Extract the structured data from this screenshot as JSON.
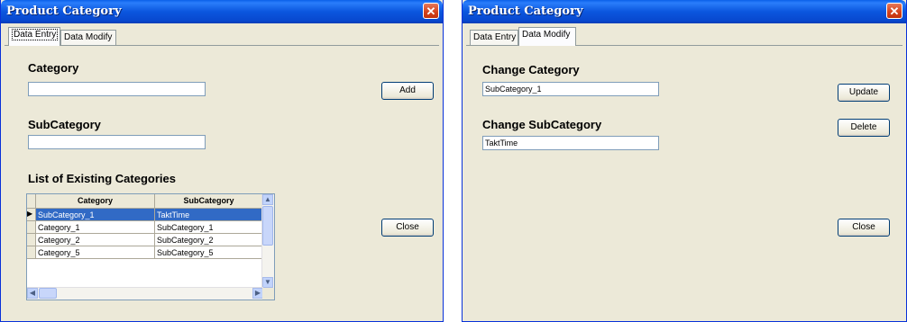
{
  "window1": {
    "title": "Product Category",
    "close_glyph": "✕",
    "tabs": [
      {
        "label": "Data Entry",
        "active": true
      },
      {
        "label": "Data Modify",
        "active": false
      }
    ],
    "category_label": "Category",
    "category_value": "",
    "add_button": "Add",
    "subcategory_label": "SubCategory",
    "subcategory_value": "",
    "list_label": "List of Existing Categories",
    "grid": {
      "columns": [
        "Category",
        "SubCategory"
      ],
      "rows": [
        {
          "category": "SubCategory_1",
          "subcategory": "TaktTime",
          "selected": true,
          "marker": "▶"
        },
        {
          "category": "Category_1",
          "subcategory": "SubCategory_1"
        },
        {
          "category": "Category_2",
          "subcategory": "SubCategory_2"
        },
        {
          "category": "Category_5",
          "subcategory": "SubCategory_5"
        }
      ]
    },
    "close_button": "Close"
  },
  "window2": {
    "title": "Product Category",
    "close_glyph": "✕",
    "tabs": [
      {
        "label": "Data Entry",
        "active": false
      },
      {
        "label": "Data Modify",
        "active": true
      }
    ],
    "change_category_label": "Change Category",
    "change_category_value": "SubCategory_1",
    "update_button": "Update",
    "change_subcategory_label": "Change SubCategory",
    "change_subcategory_value": "TaktTime",
    "delete_button": "Delete",
    "close_button": "Close"
  },
  "icons": {
    "scroll_up": "▲",
    "scroll_down": "▼",
    "scroll_left": "◀",
    "scroll_right": "▶"
  },
  "colors": {
    "title_bar": "#0a5fe9",
    "selection": "#316ac5",
    "window_bg": "#ece9d8",
    "close_button": "#d4411a"
  }
}
